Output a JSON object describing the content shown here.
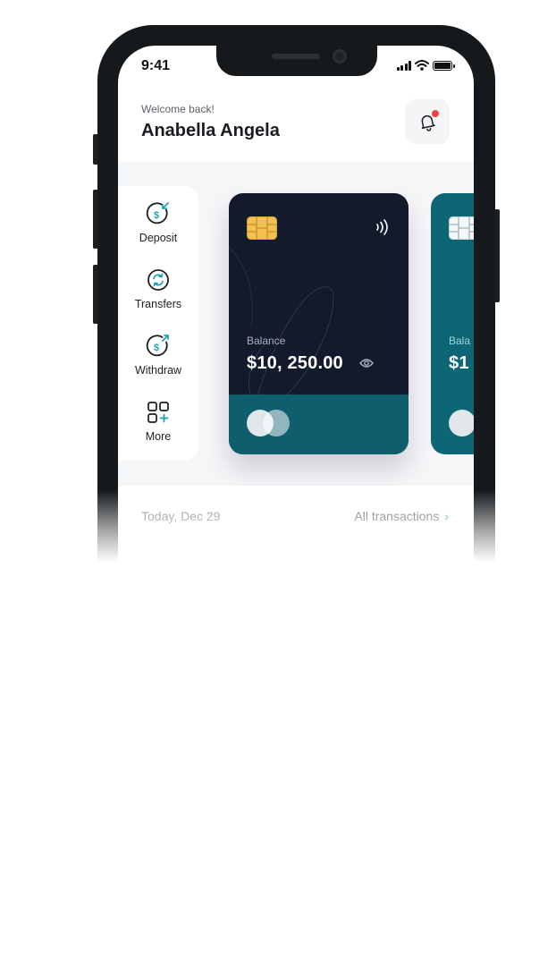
{
  "status_bar": {
    "time": "9:41"
  },
  "header": {
    "welcome": "Welcome back!",
    "user_name": "Anabella Angela",
    "notification_icon": "bell-icon",
    "notification_dot_color": "#ef4444"
  },
  "actions": [
    {
      "label": "Deposit",
      "icon": "deposit-icon"
    },
    {
      "label": "Transfers",
      "icon": "transfers-icon"
    },
    {
      "label": "Withdraw",
      "icon": "withdraw-icon"
    },
    {
      "label": "More",
      "icon": "more-icon"
    }
  ],
  "cards": {
    "main": {
      "balance_label": "Balance",
      "balance": "$10, 250.00",
      "color": "#131a2b",
      "band_color": "#0e5e6e"
    },
    "next": {
      "balance_label": "Bala",
      "balance": "$1",
      "color": "#0d6675"
    }
  },
  "transactions": {
    "date": "Today, Dec 29",
    "all_link": "All transactions",
    "accent": "#1fa0b3"
  }
}
